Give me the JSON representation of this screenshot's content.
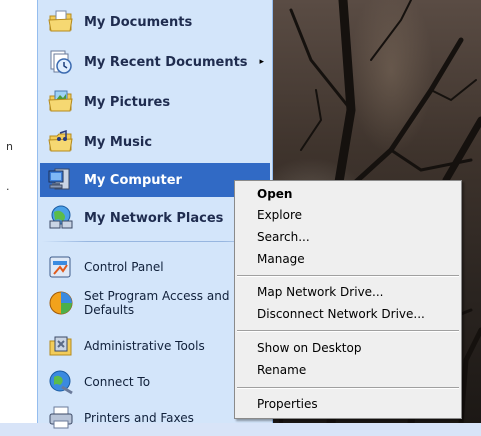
{
  "start_menu": {
    "items": [
      {
        "label": "My Documents",
        "icon": "my-documents-icon"
      },
      {
        "label": "My Recent Documents",
        "icon": "recent-documents-icon",
        "submenu_arrow": "▸"
      },
      {
        "label": "My Pictures",
        "icon": "my-pictures-icon"
      },
      {
        "label": "My Music",
        "icon": "my-music-icon"
      },
      {
        "label": "My Computer",
        "icon": "my-computer-icon",
        "highlighted": true
      },
      {
        "label": "My Network Places",
        "icon": "network-places-icon"
      },
      {
        "label": "Control Panel",
        "icon": "control-panel-icon"
      },
      {
        "label": "Set Program Access and Defaults",
        "label_line1": "Set Program Access and",
        "label_line2": "Defaults",
        "icon": "program-access-icon"
      },
      {
        "label": "Administrative Tools",
        "icon": "admin-tools-icon"
      },
      {
        "label": "Connect To",
        "icon": "connect-to-icon"
      },
      {
        "label": "Printers and Faxes",
        "icon": "printers-icon"
      }
    ]
  },
  "left_sliver": {
    "glyph1": "n",
    "glyph2": "."
  },
  "context_menu": {
    "items": [
      {
        "label": "Open",
        "default": true
      },
      {
        "label": "Explore"
      },
      {
        "label": "Search..."
      },
      {
        "label": "Manage"
      },
      {
        "label": "Map Network Drive..."
      },
      {
        "label": "Disconnect Network Drive..."
      },
      {
        "label": "Show on Desktop"
      },
      {
        "label": "Rename"
      },
      {
        "label": "Properties"
      }
    ]
  },
  "colors": {
    "menu_bg": "#d3e5fa",
    "highlight": "#316ac5",
    "context_bg": "#efefef"
  }
}
